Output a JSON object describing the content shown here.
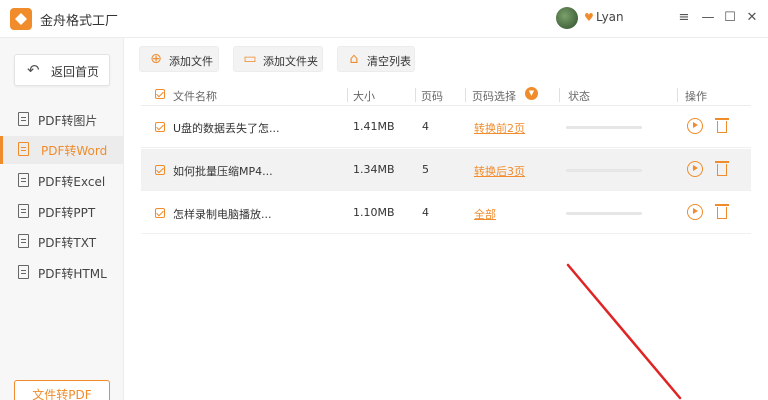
{
  "app": {
    "title": "金舟格式工厂",
    "user": "Lyan",
    "vip_icon": "heart-icon"
  },
  "window_controls": {
    "menu": "≡",
    "minimize": "—",
    "maximize": "☐",
    "close": "✕"
  },
  "sidebar": {
    "back_label": "返回首页",
    "items": [
      {
        "label": "PDF转图片",
        "active": false
      },
      {
        "label": "PDF转Word",
        "active": true
      },
      {
        "label": "PDF转Excel",
        "active": false
      },
      {
        "label": "PDF转PPT",
        "active": false
      },
      {
        "label": "PDF转TXT",
        "active": false
      },
      {
        "label": "PDF转HTML",
        "active": false
      }
    ],
    "bottom_label": "文件转PDF"
  },
  "toolbar": {
    "add_file": "添加文件",
    "add_folder": "添加文件夹",
    "clear_list": "清空列表"
  },
  "table": {
    "headers": {
      "name": "文件名称",
      "size": "大小",
      "pages": "页码",
      "page_select": "页码选择",
      "status": "状态",
      "actions": "操作"
    },
    "rows": [
      {
        "name": "U盘的数据丢失了怎...",
        "size": "1.41MB",
        "pages": "4",
        "page_select": "转换前2页",
        "progress": 0,
        "selected": false
      },
      {
        "name": "如何批量压缩MP4...",
        "size": "1.34MB",
        "pages": "5",
        "page_select": "转换后3页",
        "progress": 0,
        "selected": true
      },
      {
        "name": "怎样录制电脑播放...",
        "size": "1.10MB",
        "pages": "4",
        "page_select": "全部",
        "progress": 0,
        "selected": false
      }
    ]
  },
  "colors": {
    "accent": "#f08c2c",
    "annotation_arrow": "#e02424"
  }
}
